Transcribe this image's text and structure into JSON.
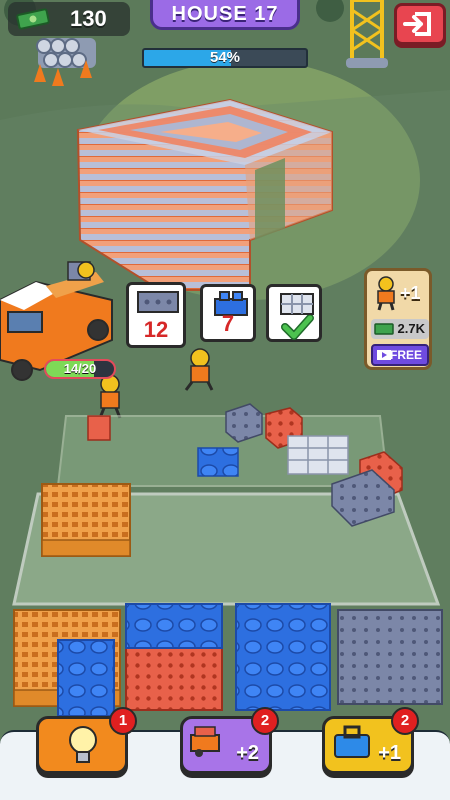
{
  "hud": {
    "cash": "130",
    "house_title": "HOUSE 17",
    "progress": 54,
    "progress_label": "54%"
  },
  "requirements": [
    {
      "material": "gray-brick",
      "count": "12",
      "done": false
    },
    {
      "material": "blue-block",
      "count": "7",
      "done": false
    },
    {
      "material": "steel-frame",
      "count": "",
      "done": true
    }
  ],
  "hire": {
    "plus_label": "+1",
    "cost": "2.7K",
    "free_label": "FREE"
  },
  "truck": {
    "load_label": "14/20",
    "load": 0.7
  },
  "boosters": [
    {
      "icon": "lightbulb-icon",
      "label": "",
      "badge": "1",
      "color": "#f28a1e"
    },
    {
      "icon": "truck-upgrade-icon",
      "label": "+2",
      "badge": "2",
      "color": "#a874e8"
    },
    {
      "icon": "toolbox-icon",
      "label": "+1",
      "badge": "2",
      "color": "#f2c21e"
    }
  ],
  "colors": {
    "grass": "#5c7a5a",
    "orange_brick": "#f0a14a",
    "red_brick": "#e8614a",
    "blue_block": "#2d6fe0",
    "gray_brick": "#7c87a8"
  }
}
